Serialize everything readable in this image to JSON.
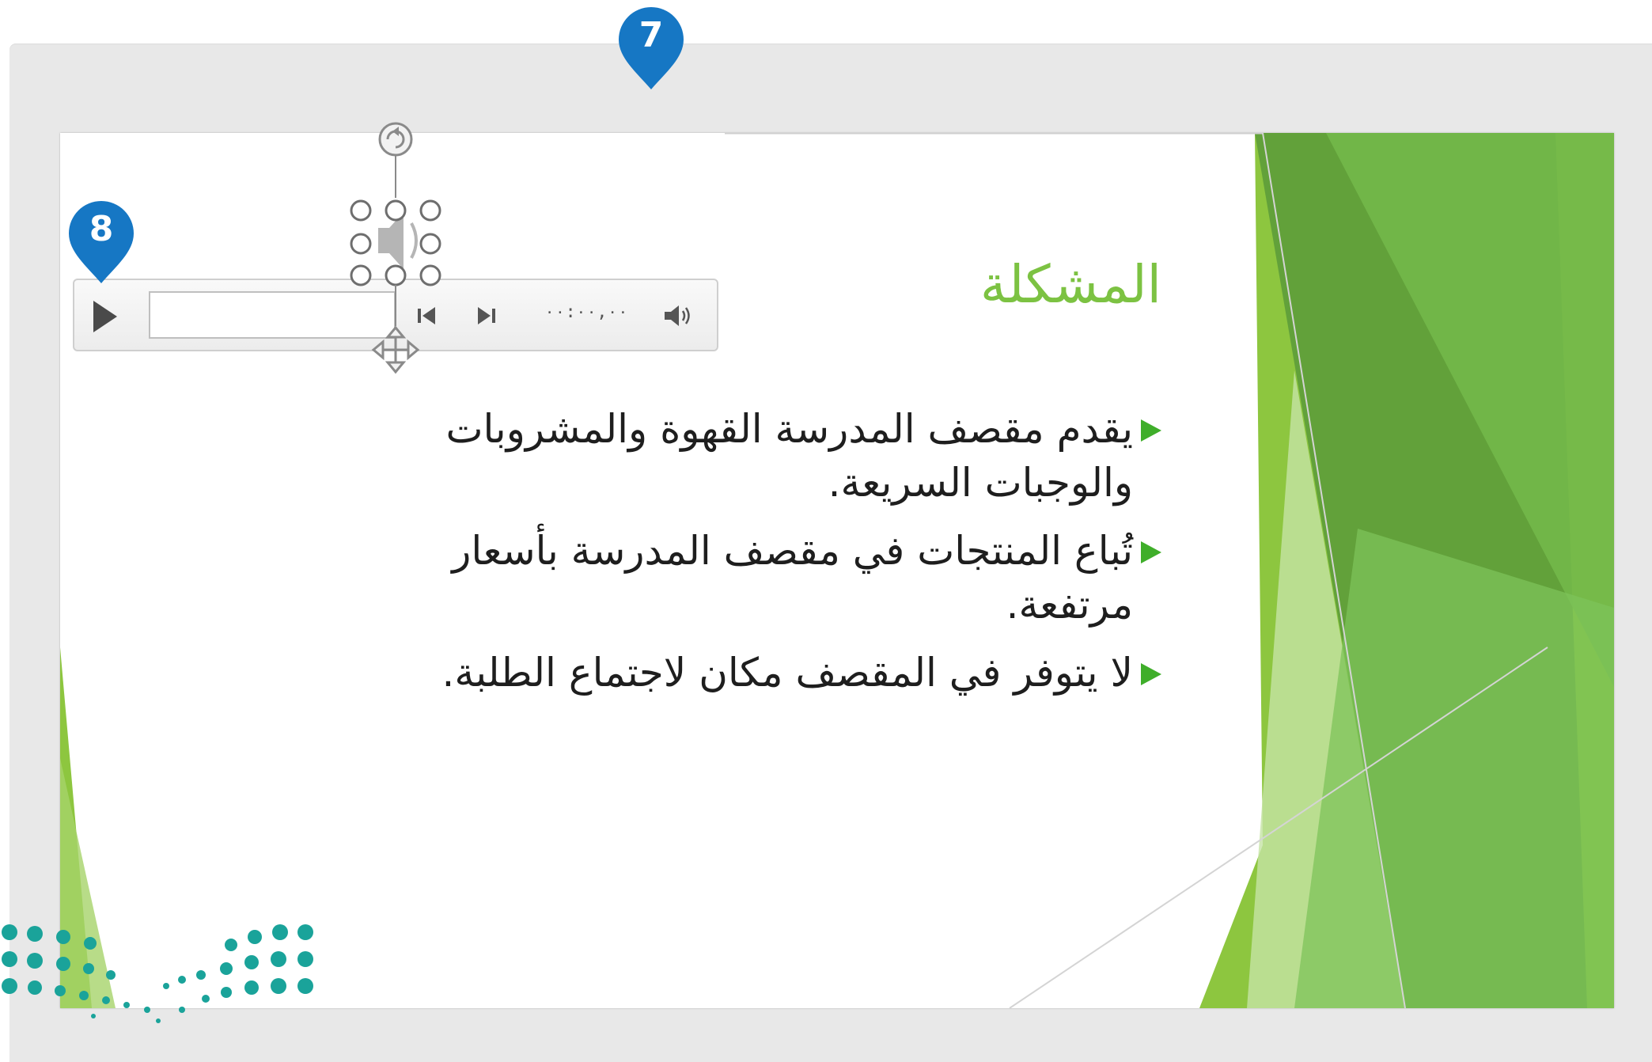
{
  "slide": {
    "title": "المشكلة",
    "bullets": [
      "يقدم مقصف المدرسة القهوة والمشروبات والوجبات السريعة.",
      "تُباع المنتجات في مقصف المدرسة بأسعار مرتفعة.",
      "لا يتوفر في المقصف مكان لاجتماع الطلبة."
    ]
  },
  "media_player": {
    "time": "٠٠:٠٠,٠٠",
    "icons": [
      "play-icon",
      "skip-back-icon",
      "skip-forward-icon",
      "volume-icon"
    ]
  },
  "selected_object": {
    "icon": "speaker-audio-icon",
    "handles": [
      "rotate-handle",
      "resize-handles",
      "move-handle"
    ]
  },
  "callouts": [
    {
      "label": "7"
    },
    {
      "label": "8"
    }
  ],
  "colors": {
    "title_green": "#7cc242",
    "bullet_green": "#3fae2a",
    "callout_blue": "#1677c4",
    "logo_teal": "#1aa39a"
  }
}
